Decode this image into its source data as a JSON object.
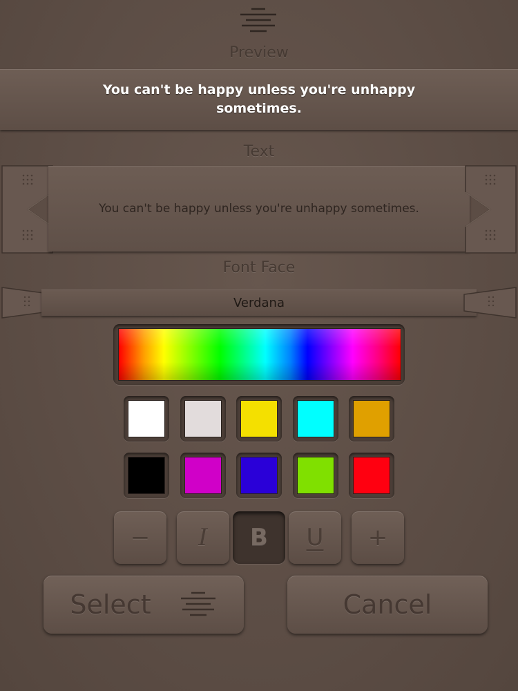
{
  "header": {
    "icon": "align-center-icon"
  },
  "preview": {
    "label": "Preview",
    "text": "You can't be happy unless you're unhappy sometimes.",
    "text_color": "#ffffff"
  },
  "text_field": {
    "label": "Text",
    "value": "You can't be happy unless you're unhappy sometimes."
  },
  "font_face": {
    "label": "Font Face",
    "value": "Verdana"
  },
  "palette": {
    "spectrum": "hue-spectrum",
    "swatches": [
      {
        "name": "white",
        "color": "#ffffff"
      },
      {
        "name": "light-gray",
        "color": "#e2dcdc"
      },
      {
        "name": "yellow",
        "color": "#f4e000"
      },
      {
        "name": "cyan",
        "color": "#00ffff"
      },
      {
        "name": "amber",
        "color": "#e0a000"
      },
      {
        "name": "black",
        "color": "#000000"
      },
      {
        "name": "magenta",
        "color": "#d000c8"
      },
      {
        "name": "blue",
        "color": "#2a00d8"
      },
      {
        "name": "lime",
        "color": "#80e000"
      },
      {
        "name": "red",
        "color": "#ff0010"
      }
    ]
  },
  "style_buttons": {
    "decrease": "−",
    "italic": "I",
    "bold": "B",
    "underline": "U",
    "increase": "+",
    "active": "bold"
  },
  "actions": {
    "select_label": "Select",
    "select_icon": "align-center-icon",
    "cancel_label": "Cancel"
  }
}
